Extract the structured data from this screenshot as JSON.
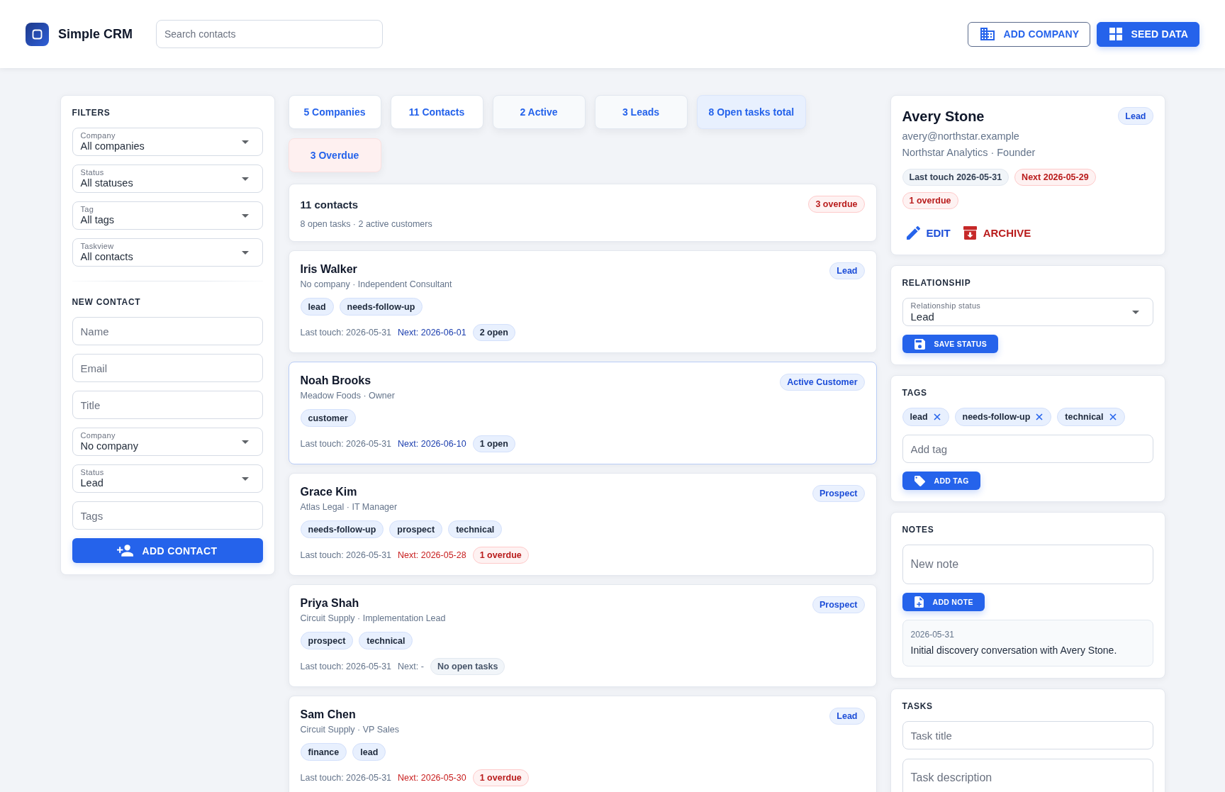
{
  "app": {
    "title": "Simple CRM"
  },
  "search": {
    "placeholder": "Search contacts"
  },
  "header_actions": [
    {
      "label": "ADD COMPANY",
      "kind": "outlined"
    },
    {
      "label": "SEED DATA",
      "kind": "filled"
    }
  ],
  "filters": {
    "title": "FILTERS",
    "selects": [
      {
        "label": "Company",
        "value": "All companies"
      },
      {
        "label": "Status",
        "value": "All statuses"
      },
      {
        "label": "Tag",
        "value": "All tags"
      },
      {
        "label": "Taskview",
        "value": "All contacts"
      }
    ]
  },
  "new_contact": {
    "title": "NEW CONTACT",
    "fields": [
      {
        "kind": "input",
        "placeholder": "Name"
      },
      {
        "kind": "input",
        "placeholder": "Email"
      },
      {
        "kind": "input",
        "placeholder": "Title"
      },
      {
        "kind": "select",
        "label": "Company",
        "value": "No company"
      },
      {
        "kind": "select",
        "label": "Status",
        "value": "Lead"
      },
      {
        "kind": "input",
        "placeholder": "Tags"
      }
    ],
    "button": "ADD CONTACT"
  },
  "stats": [
    {
      "label": "5 Companies",
      "kind": "plain"
    },
    {
      "label": "11 Contacts",
      "kind": "plain"
    },
    {
      "label": "2 Active",
      "kind": "muted"
    },
    {
      "label": "3 Leads",
      "kind": "muted"
    },
    {
      "label": "8 Open tasks total",
      "kind": "info"
    },
    {
      "label": "3 Overdue",
      "kind": "danger"
    }
  ],
  "summary": {
    "title": "11 contacts",
    "badge": "3 overdue",
    "subtitle": "8 open tasks · 2 active customers"
  },
  "contacts": [
    {
      "name": "Iris Walker",
      "subtitle": "No company · Independent Consultant",
      "status": "Lead",
      "selected": false,
      "tags": [
        "lead",
        "needs-follow-up"
      ],
      "last_touch": "Last touch: 2026-05-31",
      "next": {
        "text": "Next: 2026-06-01",
        "kind": "upcoming"
      },
      "tasks": {
        "text": "2 open",
        "kind": "open"
      }
    },
    {
      "name": "Noah Brooks",
      "subtitle": "Meadow Foods · Owner",
      "status": "Active Customer",
      "selected": true,
      "tags": [
        "customer"
      ],
      "last_touch": "Last touch: 2026-05-31",
      "next": {
        "text": "Next: 2026-06-10",
        "kind": "upcoming"
      },
      "tasks": {
        "text": "1 open",
        "kind": "open"
      }
    },
    {
      "name": "Grace Kim",
      "subtitle": "Atlas Legal · IT Manager",
      "status": "Prospect",
      "selected": false,
      "tags": [
        "needs-follow-up",
        "prospect",
        "technical"
      ],
      "last_touch": "Last touch: 2026-05-31",
      "next": {
        "text": "Next: 2026-05-28",
        "kind": "overdue"
      },
      "tasks": {
        "text": "1 overdue",
        "kind": "overdue"
      }
    },
    {
      "name": "Priya Shah",
      "subtitle": "Circuit Supply · Implementation Lead",
      "status": "Prospect",
      "selected": false,
      "tags": [
        "prospect",
        "technical"
      ],
      "last_touch": "Last touch: 2026-05-31",
      "next": {
        "text": "Next: -",
        "kind": "none"
      },
      "tasks": {
        "text": "No open tasks",
        "kind": "none"
      }
    },
    {
      "name": "Sam Chen",
      "subtitle": "Circuit Supply · VP Sales",
      "status": "Lead",
      "selected": false,
      "tags": [
        "finance",
        "lead"
      ],
      "last_touch": "Last touch: 2026-05-31",
      "next": {
        "text": "Next: 2026-05-30",
        "kind": "overdue"
      },
      "tasks": {
        "text": "1 overdue",
        "kind": "overdue"
      }
    }
  ],
  "detail": {
    "name": "Avery Stone",
    "status": "Lead",
    "email": "avery@northstar.example",
    "company_line": "Northstar Analytics · Founder",
    "chips": [
      {
        "text": "Last touch 2026-05-31",
        "kind": "neutral"
      },
      {
        "text": "Next 2026-05-29",
        "kind": "danger"
      },
      {
        "text": "1 overdue",
        "kind": "danger"
      }
    ],
    "actions": [
      {
        "label": "EDIT",
        "kind": "edit"
      },
      {
        "label": "ARCHIVE",
        "kind": "archive"
      }
    ]
  },
  "relationship": {
    "title": "RELATIONSHIP",
    "select": {
      "label": "Relationship status",
      "value": "Lead"
    },
    "button": "SAVE STATUS"
  },
  "tags_panel": {
    "title": "TAGS",
    "items": [
      "lead",
      "needs-follow-up",
      "technical"
    ],
    "field": {
      "placeholder": "Add tag"
    },
    "button": "ADD TAG"
  },
  "notes": {
    "title": "NOTES",
    "field": {
      "placeholder": "New note"
    },
    "button": "ADD NOTE",
    "items": [
      {
        "date": "2026-05-31",
        "text": "Initial discovery conversation with Avery Stone."
      }
    ]
  },
  "tasks": {
    "title": "TASKS",
    "fields": [
      {
        "kind": "input",
        "placeholder": "Task title"
      },
      {
        "kind": "textarea",
        "placeholder": "Task description"
      }
    ]
  }
}
